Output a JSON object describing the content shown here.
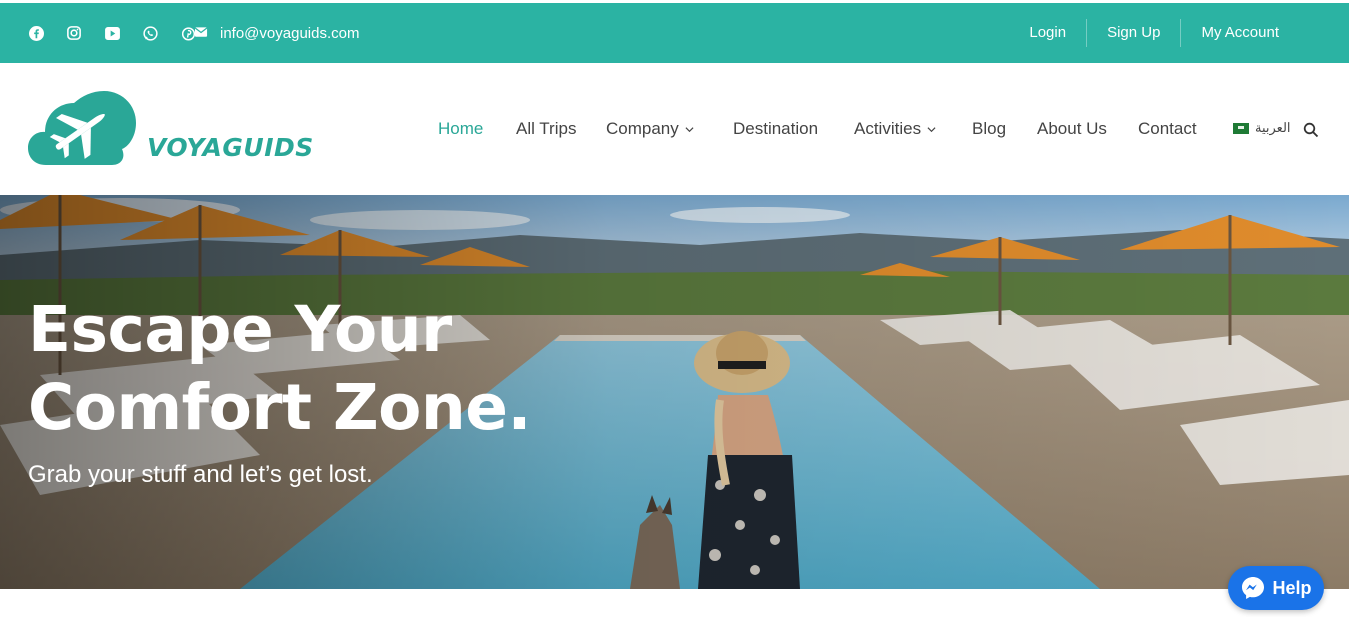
{
  "topbar": {
    "social_icons": [
      "facebook-icon",
      "instagram-icon",
      "youtube-icon",
      "whatsapp-icon",
      "pinterest-icon"
    ],
    "email": "info@voyaguids.com",
    "links": {
      "login": "Login",
      "signup": "Sign Up",
      "account": "My Account"
    },
    "bg_color": "#2bb3a3"
  },
  "header": {
    "logo_text": "VOYAGUIDS",
    "nav": {
      "home": "Home",
      "all_trips": "All Trips",
      "company": "Company",
      "destination": "Destination",
      "activities": "Activities",
      "blog": "Blog",
      "about": "About Us",
      "contact": "Contact"
    },
    "language": "العربية",
    "accent_color": "#2aa797"
  },
  "hero": {
    "headline_line1": "Escape Your",
    "headline_line2": "Comfort Zone.",
    "subheadline": "Grab your stuff and let’s get lost."
  },
  "chat": {
    "label": "Help",
    "color": "#1a73e8"
  }
}
